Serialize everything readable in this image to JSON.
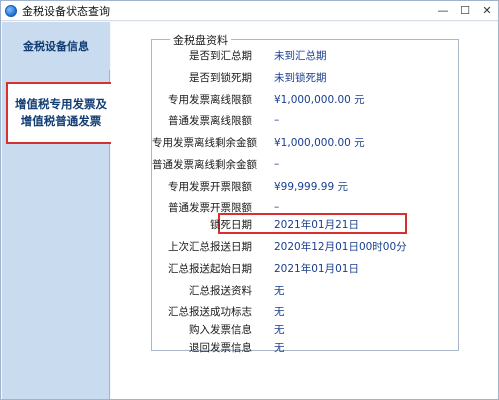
{
  "window": {
    "title": "金税设备状态查询",
    "controls": [
      "—",
      "☐",
      "✕"
    ]
  },
  "sidebar": {
    "items": [
      {
        "label": "金税设备信息"
      },
      {
        "label": "增值税专用发票及增值税普通发票"
      }
    ]
  },
  "group": {
    "legend": "金税盘资料",
    "rows": [
      {
        "label": "是否到汇总期",
        "value": "未到汇总期"
      },
      {
        "label": "是否到锁死期",
        "value": "未到锁死期"
      },
      {
        "label": "专用发票离线限额",
        "value": "¥1,000,000.00 元"
      },
      {
        "label": "普通发票离线限额",
        "value": "–"
      },
      {
        "label": "专用发票离线剩余金额",
        "value": "¥1,000,000.00 元"
      },
      {
        "label": "普通发票离线剩余金额",
        "value": "–"
      },
      {
        "label": "专用发票开票限额",
        "value": "¥99,999.99 元"
      },
      {
        "label": "普通发票开票限额",
        "value": "–"
      },
      {
        "label": "锁死日期",
        "value": "2021年01月21日"
      },
      {
        "label": "上次汇总报送日期",
        "value": "2020年12月01日00时00分"
      },
      {
        "label": "汇总报送起始日期",
        "value": "2021年01月01日"
      },
      {
        "label": "汇总报送资料",
        "value": "无"
      },
      {
        "label": "汇总报送成功标志",
        "value": "无"
      },
      {
        "label": "购入发票信息",
        "value": "无"
      },
      {
        "label": "退回发票信息",
        "value": "无"
      }
    ]
  },
  "colors": {
    "accent_red": "#d63030",
    "value_blue": "#1a3f8f",
    "sidebar_bg": "#c9dcef"
  }
}
